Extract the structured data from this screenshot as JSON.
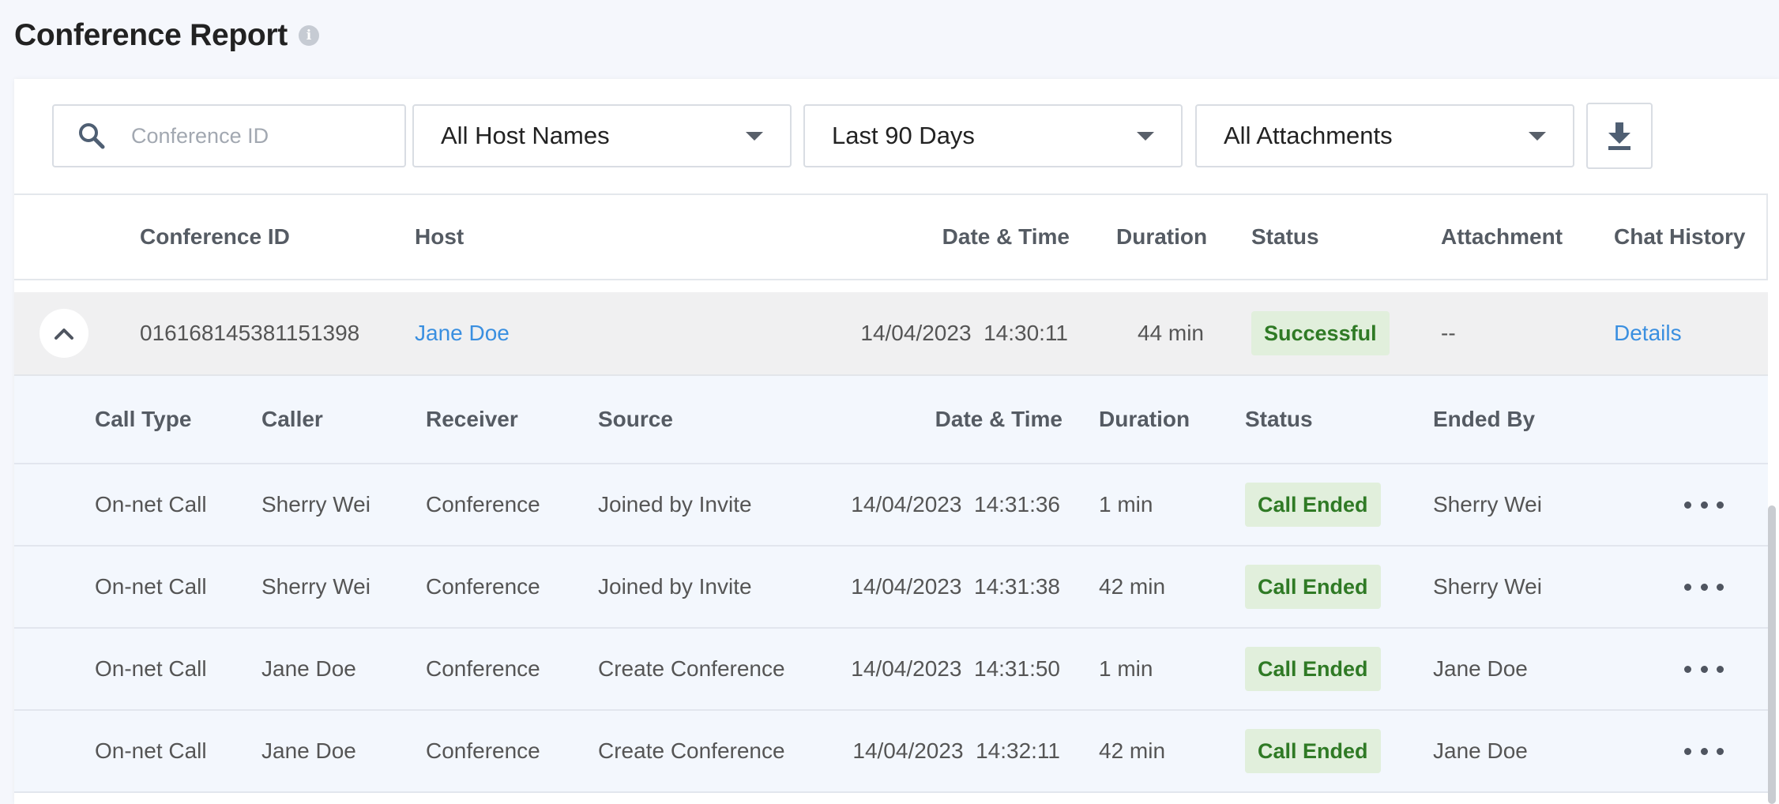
{
  "page": {
    "title": "Conference Report",
    "info_icon": "i"
  },
  "toolbar": {
    "search": {
      "placeholder": "Conference ID",
      "value": ""
    },
    "host_filter": "All Host Names",
    "date_filter": "Last 90 Days",
    "attachment_filter": "All Attachments"
  },
  "table": {
    "headers": [
      "Conference ID",
      "Host",
      "Date & Time",
      "Duration",
      "Status",
      "Attachment",
      "Chat History"
    ],
    "row": {
      "conference_id": "016168145381151398",
      "host": "Jane Doe",
      "date": "14/04/2023",
      "time": "14:30:11",
      "duration": "44 min",
      "status": "Successful",
      "attachment": "--",
      "chat_history": "Details"
    }
  },
  "subtable": {
    "headers": [
      "Call Type",
      "Caller",
      "Receiver",
      "Source",
      "Date & Time",
      "Duration",
      "Status",
      "Ended By"
    ],
    "rows": [
      {
        "call_type": "On-net Call",
        "caller": "Sherry Wei",
        "receiver": "Conference",
        "source": "Joined by Invite",
        "date": "14/04/2023",
        "time": "14:31:36",
        "duration": "1 min",
        "status": "Call Ended",
        "ended_by": "Sherry Wei"
      },
      {
        "call_type": "On-net Call",
        "caller": "Sherry Wei",
        "receiver": "Conference",
        "source": "Joined by Invite",
        "date": "14/04/2023",
        "time": "14:31:38",
        "duration": "42 min",
        "status": "Call Ended",
        "ended_by": "Sherry Wei"
      },
      {
        "call_type": "On-net Call",
        "caller": "Jane Doe",
        "receiver": "Conference",
        "source": "Create Conference",
        "date": "14/04/2023",
        "time": "14:31:50",
        "duration": "1 min",
        "status": "Call Ended",
        "ended_by": "Jane Doe"
      },
      {
        "call_type": "On-net Call",
        "caller": "Jane Doe",
        "receiver": "Conference",
        "source": "Create Conference",
        "date": "14/04/2023",
        "time": "14:32:11",
        "duration": "42 min",
        "status": "Call Ended",
        "ended_by": "Jane Doe"
      }
    ]
  },
  "colors": {
    "link": "#3a8fe0",
    "success_bg": "#e1efdc",
    "success_text": "#2f7a25",
    "page_bg": "#f5f7fc"
  },
  "icons": {
    "search": "search-icon",
    "dropdown": "caret-down-icon",
    "download": "download-icon",
    "collapse": "chevron-up-icon",
    "more": "more-horizontal-icon",
    "info": "info-icon"
  }
}
